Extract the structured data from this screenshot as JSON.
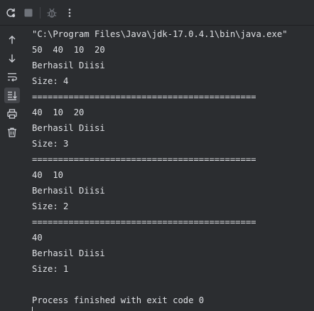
{
  "toolbar": {
    "rerun_icon": "rerun-icon",
    "stop_icon": "stop-icon",
    "debug_icon": "bug-icon",
    "more_icon": "more-vertical-icon"
  },
  "sidebar": {
    "items": [
      {
        "name": "scroll-up",
        "icon": "arrow-up-icon"
      },
      {
        "name": "scroll-down",
        "icon": "arrow-down-icon"
      },
      {
        "name": "soft-wrap",
        "icon": "soft-wrap-icon"
      },
      {
        "name": "scroll-to-end",
        "icon": "scroll-to-end-icon",
        "active": true
      },
      {
        "name": "print",
        "icon": "printer-icon"
      },
      {
        "name": "clear-all",
        "icon": "trash-icon"
      }
    ]
  },
  "console": {
    "lines": [
      "\"C:\\Program Files\\Java\\jdk-17.0.4.1\\bin\\java.exe\"",
      "50  40  10  20",
      "Berhasil Diisi",
      "Size: 4",
      "===========================================",
      "40  10  20",
      "Berhasil Diisi",
      "Size: 3",
      "===========================================",
      "40  10",
      "Berhasil Diisi",
      "Size: 2",
      "===========================================",
      "40",
      "Berhasil Diisi",
      "Size: 1",
      "",
      "Process finished with exit code 0"
    ]
  },
  "colors": {
    "background": "#2b2d30",
    "text": "#dfe1e5",
    "icon": "#ced0d6",
    "active_button": "#43454a",
    "disabled_icon": "#6f737a"
  }
}
